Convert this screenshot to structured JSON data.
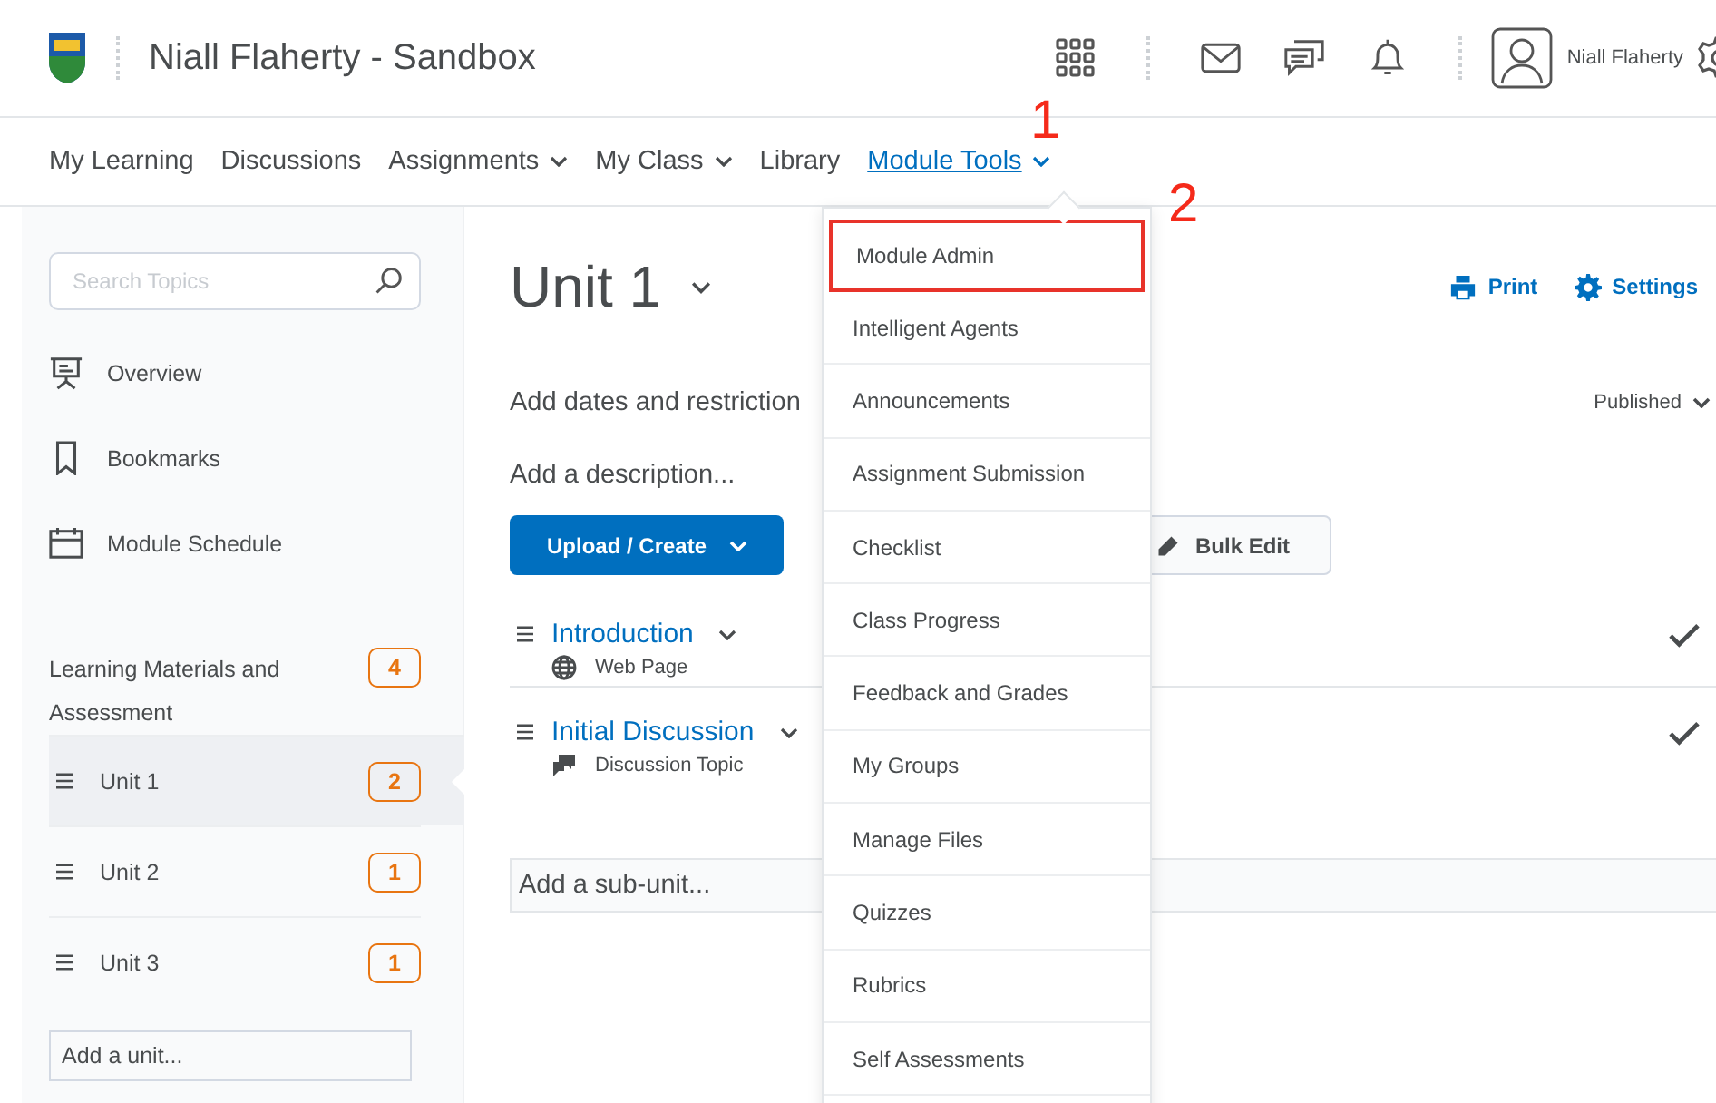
{
  "header": {
    "title": "Niall Flaherty - Sandbox",
    "user_name": "Niall Flaherty"
  },
  "nav": [
    {
      "label": "My Learning",
      "has_menu": false,
      "selected": false
    },
    {
      "label": "Discussions",
      "has_menu": false,
      "selected": false
    },
    {
      "label": "Assignments",
      "has_menu": true,
      "selected": false
    },
    {
      "label": "My Class",
      "has_menu": true,
      "selected": false
    },
    {
      "label": "Library",
      "has_menu": false,
      "selected": false
    },
    {
      "label": "Module Tools",
      "has_menu": true,
      "selected": true
    }
  ],
  "annotations": [
    {
      "text": "1"
    },
    {
      "text": "2"
    }
  ],
  "sidebar": {
    "search": {
      "placeholder": "Search Topics"
    },
    "links": [
      {
        "label": "Overview",
        "kind": "overview"
      },
      {
        "label": "Bookmarks",
        "kind": "bookmarks"
      },
      {
        "label": "Module Schedule",
        "kind": "schedule"
      }
    ],
    "section": {
      "label": "Learning Materials and Assessment",
      "count": "4"
    },
    "units": [
      {
        "label": "Unit 1",
        "count": "2",
        "selected": true
      },
      {
        "label": "Unit 2",
        "count": "1",
        "selected": false
      },
      {
        "label": "Unit 3",
        "count": "1",
        "selected": false
      }
    ],
    "add_unit": {
      "placeholder": "Add a unit..."
    }
  },
  "content": {
    "title": "Unit 1",
    "actions": [
      {
        "label": "Print",
        "kind": "print"
      },
      {
        "label": "Settings",
        "kind": "settings"
      }
    ],
    "restrictions": "Add dates and restriction",
    "status": "Published",
    "description": {
      "placeholder": "Add a description..."
    },
    "upload_label": "Upload / Create",
    "bulk_edit_label": "Bulk Edit",
    "topics": [
      {
        "title": "Introduction",
        "type": "Web Page",
        "kind": "web",
        "completed": true
      },
      {
        "title": "Initial Discussion",
        "type": "Discussion Topic",
        "kind": "discussion",
        "completed": true
      }
    ],
    "add_subunit": {
      "placeholder": "Add a sub-unit..."
    }
  },
  "menu": {
    "items": [
      {
        "label": "Module Admin",
        "highlighted": true
      },
      {
        "label": "Intelligent Agents",
        "highlighted": false
      },
      {
        "label": "Announcements",
        "highlighted": false
      },
      {
        "label": "Assignment Submission",
        "highlighted": false
      },
      {
        "label": "Checklist",
        "highlighted": false
      },
      {
        "label": "Class Progress",
        "highlighted": false
      },
      {
        "label": "Feedback and Grades",
        "highlighted": false
      },
      {
        "label": "My Groups",
        "highlighted": false
      },
      {
        "label": "Manage Files",
        "highlighted": false
      },
      {
        "label": "Quizzes",
        "highlighted": false
      },
      {
        "label": "Rubrics",
        "highlighted": false
      },
      {
        "label": "Self Assessments",
        "highlighted": false
      }
    ]
  }
}
